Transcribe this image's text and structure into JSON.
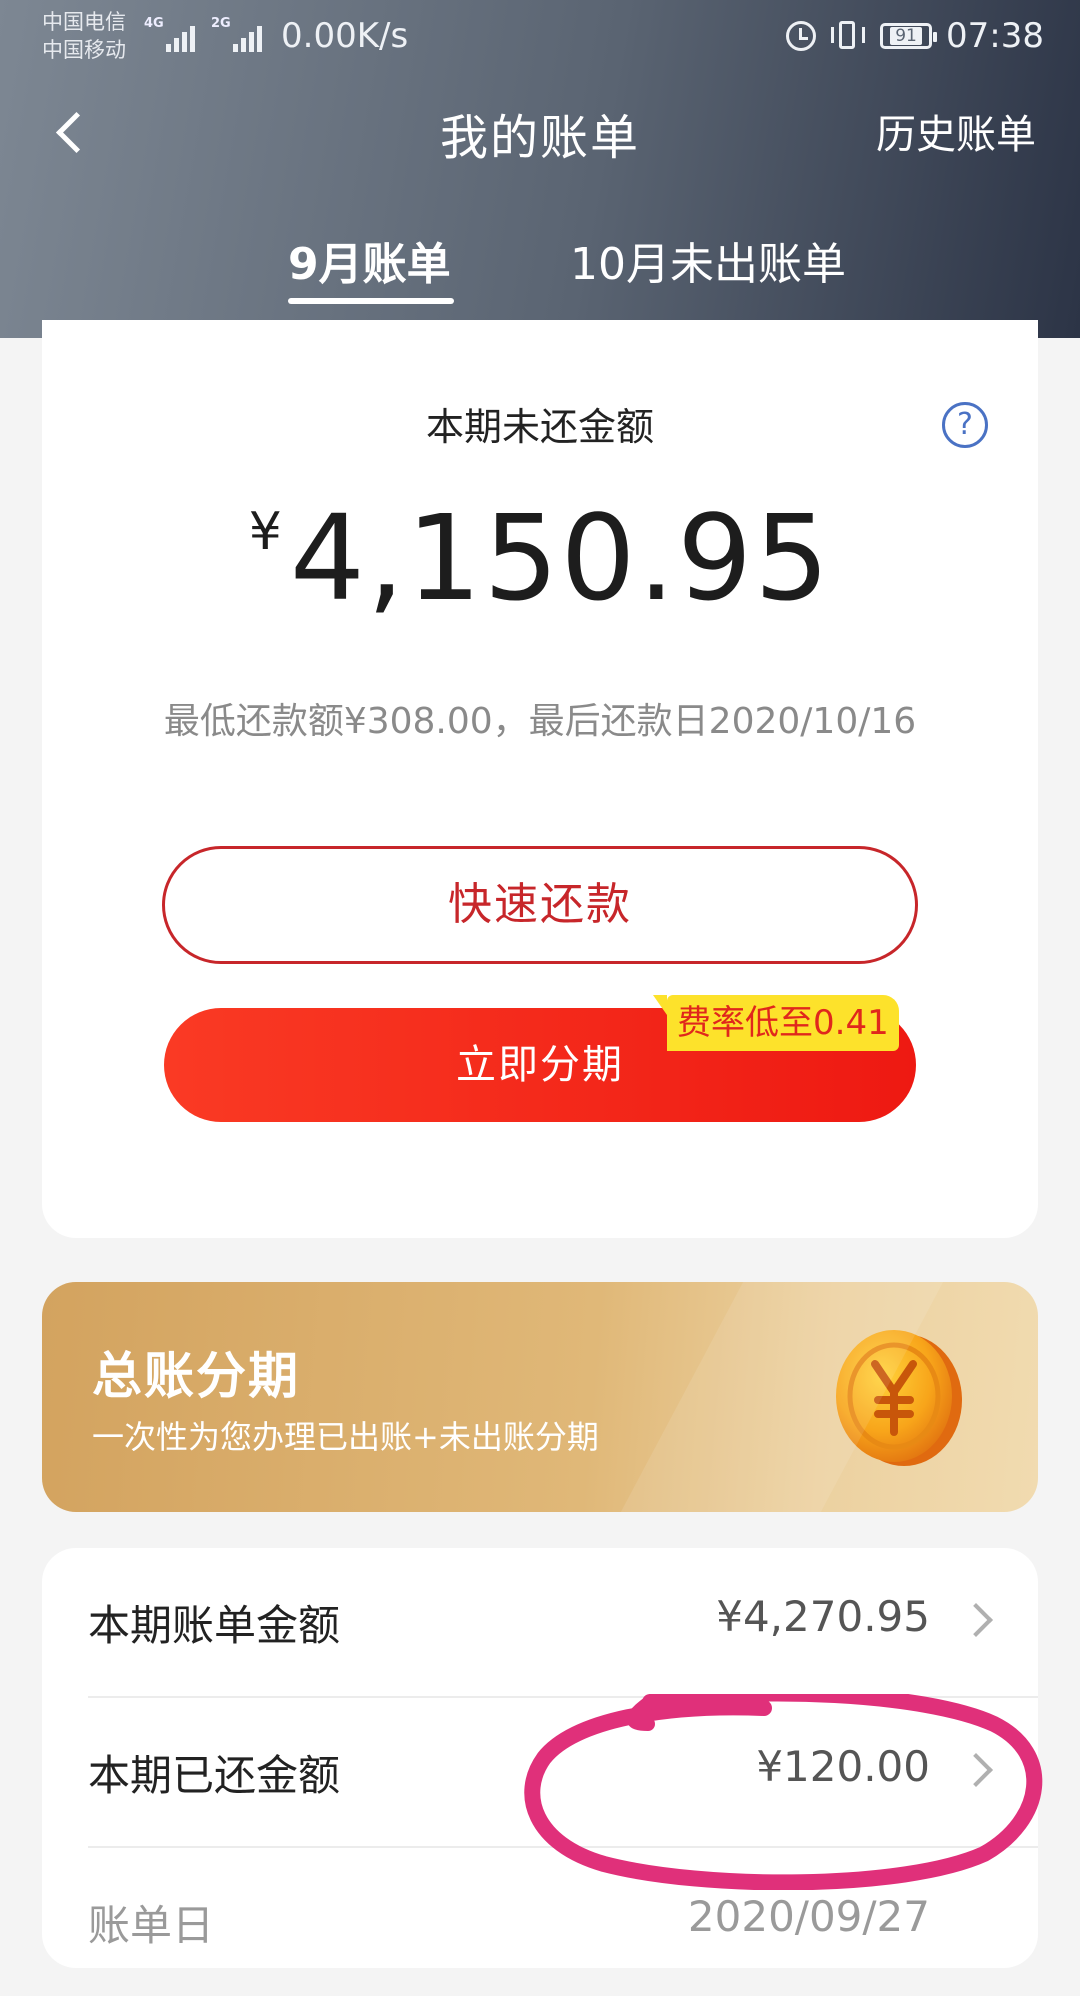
{
  "status_bar": {
    "carrier_1": "中国电信",
    "carrier_2": "中国移动",
    "network_1": "4G",
    "network_2": "2G",
    "speed": "0.00K/s",
    "battery": "91",
    "time": "07:38",
    "icons": [
      "alarm-icon",
      "vibrate-icon",
      "battery-icon",
      "signal-icon"
    ]
  },
  "header": {
    "title": "我的账单",
    "history_link": "历史账单",
    "back_icon": "chevron-left-icon",
    "tabs": [
      {
        "label": "9月账单",
        "active": true
      },
      {
        "label": "10月未出账单",
        "active": false
      }
    ]
  },
  "bill": {
    "unpaid_label": "本期未还金额",
    "currency": "¥",
    "amount": "4,150.95",
    "due_info": "最低还款额¥308.00，最后还款日2020/10/16",
    "help_icon": "question-icon",
    "quick_pay_label": "快速还款",
    "installment_label": "立即分期",
    "rate_badge": "费率低至0.41"
  },
  "banner": {
    "title": "总账分期",
    "subtitle": "一次性为您办理已出账+未出账分期",
    "icon": "yuan-coin-icon"
  },
  "summary": {
    "rows": [
      {
        "label": "本期账单金额",
        "value": "¥4,270.95"
      },
      {
        "label": "本期已还金额",
        "value": "¥120.00"
      },
      {
        "label": "账单日",
        "value": "2020/09/27"
      }
    ]
  },
  "colors": {
    "header_dark": "#2c3446",
    "header_light": "#7d8793",
    "accent_red": "#c7262a",
    "install_red": "#ee1912",
    "badge_yellow": "#fde22b",
    "banner_gold": "#d3a35f",
    "annotation_pink": "#e0307a"
  }
}
